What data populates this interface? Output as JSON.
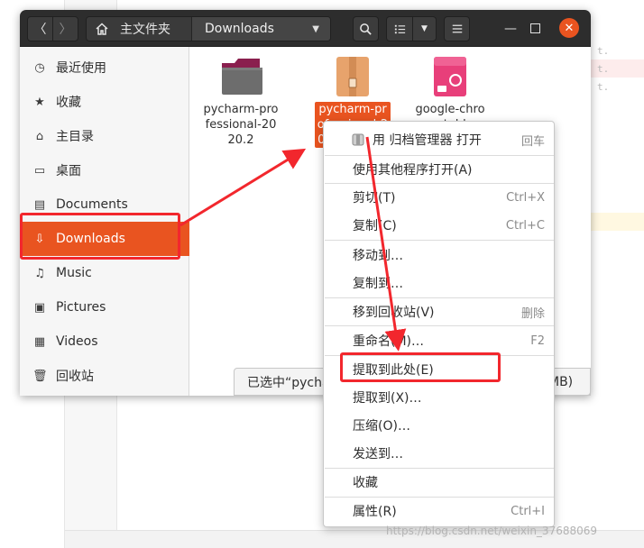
{
  "colors": {
    "accent": "#e95420",
    "headerbar": "#2d2d2d",
    "annotation": "#f2272d"
  },
  "headerbar": {
    "back_icon": "〈",
    "forward_icon": "〉",
    "path_home_label": "主文件夹",
    "path_current_label": "Downloads",
    "dropdown_caret": "▼",
    "view_dropdown_caret": "▼",
    "minimize_glyph": "—",
    "close_glyph": "✕"
  },
  "sidebar": {
    "items": [
      {
        "label": "最近使用",
        "icon": "clock-icon"
      },
      {
        "label": "收藏",
        "icon": "star-icon"
      },
      {
        "label": "主目录",
        "icon": "home-icon"
      },
      {
        "label": "桌面",
        "icon": "desktop-icon"
      },
      {
        "label": "Documents",
        "icon": "document-icon"
      },
      {
        "label": "Downloads",
        "icon": "download-icon"
      },
      {
        "label": "Music",
        "icon": "music-icon"
      },
      {
        "label": "Pictures",
        "icon": "picture-icon"
      },
      {
        "label": "Videos",
        "icon": "video-icon"
      },
      {
        "label": "回收站",
        "icon": "trash-icon"
      }
    ]
  },
  "files": [
    {
      "label": "pycharm-professional-2020.2"
    },
    {
      "label": "pycharm-professional-2020.2.tar.gz"
    },
    {
      "label": "google-chrome-stable_current_amd64.deb"
    }
  ],
  "status": {
    "text": "已选中“pycharm-professional-2020.2.tar.gz”(",
    "tail": "MB)"
  },
  "context_menu": {
    "items": [
      {
        "label": "用 归档管理器 打开",
        "accel": "回车"
      },
      {
        "label": "使用其他程序打开(A)",
        "accel": ""
      },
      {
        "label": "剪切(T)",
        "accel": "Ctrl+X"
      },
      {
        "label": "复制(C)",
        "accel": "Ctrl+C"
      },
      {
        "label": "移动到…",
        "accel": ""
      },
      {
        "label": "复制到…",
        "accel": ""
      },
      {
        "label": "移到回收站(V)",
        "accel": "删除"
      },
      {
        "label": "重命名(M)…",
        "accel": "F2"
      },
      {
        "label": "提取到此处(E)",
        "accel": ""
      },
      {
        "label": "提取到(X)…",
        "accel": ""
      },
      {
        "label": "压缩(O)…",
        "accel": ""
      },
      {
        "label": "发送到…",
        "accel": ""
      },
      {
        "label": "收藏",
        "accel": ""
      },
      {
        "label": "属性(R)",
        "accel": "Ctrl+I"
      }
    ]
  },
  "background_code": [
    "t.",
    "t.",
    "t."
  ],
  "watermark": "https://blog.csdn.net/weixin_37688069"
}
